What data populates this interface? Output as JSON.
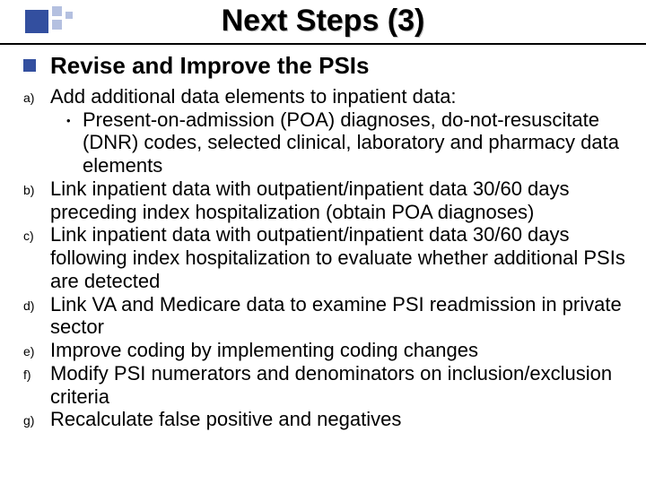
{
  "title": "Next Steps (3)",
  "heading": "Revise and Improve the PSIs",
  "items": [
    {
      "label": "a)",
      "text": "Add additional data elements to inpatient data:",
      "sub": [
        "Present-on-admission (POA) diagnoses, do-not-resuscitate (DNR) codes, selected clinical, laboratory and pharmacy data elements"
      ]
    },
    {
      "label": "b)",
      "text": "Link inpatient data with outpatient/inpatient data 30/60 days preceding index hospitalization (obtain POA diagnoses)"
    },
    {
      "label": "c)",
      "text": "Link inpatient data with outpatient/inpatient data 30/60 days following index hospitalization to evaluate whether additional PSIs are detected"
    },
    {
      "label": "d)",
      "text": "Link VA and Medicare data to examine PSI readmission in private sector"
    },
    {
      "label": "e)",
      "text": "Improve coding by implementing coding changes"
    },
    {
      "label": "f)",
      "text": "Modify PSI numerators and denominators on inclusion/exclusion criteria"
    },
    {
      "label": "g)",
      "text": "Recalculate false positive and negatives"
    }
  ]
}
